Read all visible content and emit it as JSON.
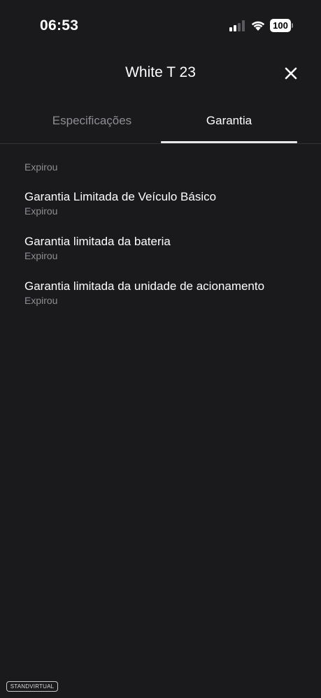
{
  "status_bar": {
    "time": "06:53",
    "battery": "100",
    "icons": [
      "cellular-signal-icon",
      "wifi-icon",
      "battery-icon"
    ]
  },
  "header": {
    "title": "White T 23",
    "close_icon": "close-icon"
  },
  "tabs": [
    {
      "label": "Especificações",
      "selected": false
    },
    {
      "label": "Garantia",
      "selected": true
    }
  ],
  "warranty": {
    "overall_status": "Expirou",
    "items": [
      {
        "title": "Garantia Limitada de Veículo Básico",
        "status": "Expirou"
      },
      {
        "title": "Garantia limitada da bateria",
        "status": "Expirou"
      },
      {
        "title": "Garantia limitada da unidade de acionamento",
        "status": "Expirou"
      }
    ]
  },
  "watermark": {
    "text": "STANDVIRTUAL"
  },
  "colors": {
    "background": "#1a1a1c",
    "text_primary": "#ffffff",
    "text_secondary": "#8e8e93",
    "tab_indicator": "#e8e8ea",
    "divider": "#323235"
  }
}
